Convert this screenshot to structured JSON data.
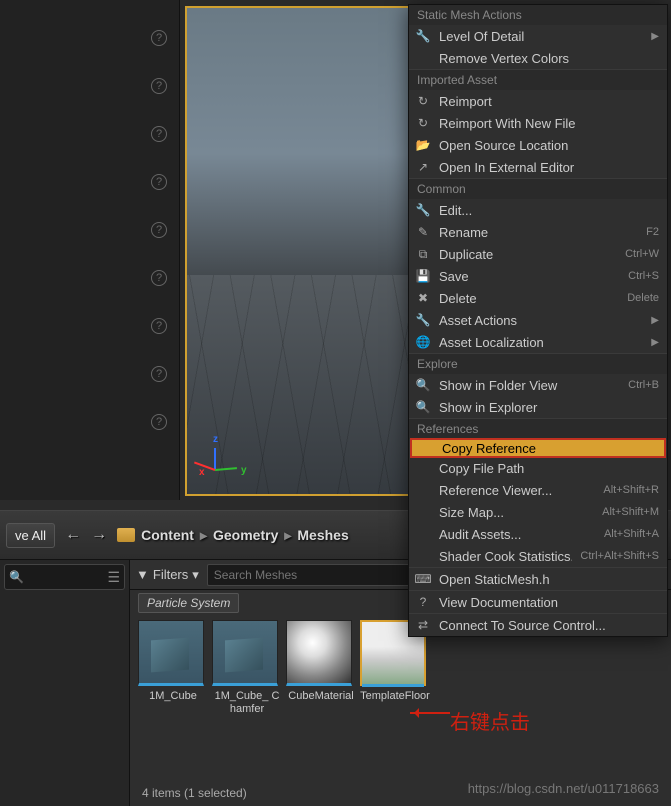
{
  "viewport": {
    "axis": {
      "x": "x",
      "y": "y",
      "z": "z"
    }
  },
  "toolbar": {
    "save_all": "ve All",
    "breadcrumb": [
      "Content",
      "Geometry",
      "Meshes"
    ]
  },
  "filters": {
    "label": "Filters",
    "search_placeholder": "Search Meshes",
    "tag": "Particle System"
  },
  "assets": [
    {
      "label": "1M_Cube",
      "kind": "cube"
    },
    {
      "label": "1M_Cube_Chamfer",
      "kind": "cube"
    },
    {
      "label": "CubeMaterial",
      "kind": "material"
    },
    {
      "label": "TemplateFloor",
      "kind": "floor"
    }
  ],
  "status": "4 items (1 selected)",
  "annotation_text": "右键点击",
  "watermark": "https://blog.csdn.net/u011718663",
  "menu": {
    "sections": [
      {
        "title": "Static Mesh Actions",
        "items": [
          {
            "icon": "wrench",
            "label": "Level Of Detail",
            "sub": true
          },
          {
            "icon": "",
            "label": "Remove Vertex Colors"
          }
        ]
      },
      {
        "title": "Imported Asset",
        "items": [
          {
            "icon": "reimport",
            "label": "Reimport"
          },
          {
            "icon": "reimport",
            "label": "Reimport With New File"
          },
          {
            "icon": "folder-open",
            "label": "Open Source Location"
          },
          {
            "icon": "external",
            "label": "Open In External Editor"
          }
        ]
      },
      {
        "title": "Common",
        "items": [
          {
            "icon": "wrench",
            "label": "Edit..."
          },
          {
            "icon": "rename",
            "label": "Rename",
            "shortcut": "F2"
          },
          {
            "icon": "duplicate",
            "label": "Duplicate",
            "shortcut": "Ctrl+W"
          },
          {
            "icon": "save",
            "label": "Save",
            "shortcut": "Ctrl+S"
          },
          {
            "icon": "delete",
            "label": "Delete",
            "shortcut": "Delete"
          },
          {
            "icon": "wrench",
            "label": "Asset Actions",
            "sub": true
          },
          {
            "icon": "globe",
            "label": "Asset Localization",
            "sub": true
          }
        ]
      },
      {
        "title": "Explore",
        "items": [
          {
            "icon": "search",
            "label": "Show in Folder View",
            "shortcut": "Ctrl+B"
          },
          {
            "icon": "search",
            "label": "Show in Explorer"
          }
        ]
      },
      {
        "title": "References",
        "items": [
          {
            "icon": "",
            "label": "Copy Reference",
            "highlight": true
          },
          {
            "icon": "",
            "label": "Copy File Path"
          },
          {
            "icon": "",
            "label": "Reference Viewer...",
            "shortcut": "Alt+Shift+R"
          },
          {
            "icon": "",
            "label": "Size Map...",
            "shortcut": "Alt+Shift+M"
          },
          {
            "icon": "",
            "label": "Audit Assets...",
            "shortcut": "Alt+Shift+A"
          },
          {
            "icon": "",
            "label": "Shader Cook Statistics...",
            "shortcut": "Ctrl+Alt+Shift+S"
          }
        ]
      },
      {
        "title": "",
        "items": [
          {
            "icon": "code",
            "label": "Open StaticMesh.h"
          }
        ]
      },
      {
        "title": "",
        "items": [
          {
            "icon": "help",
            "label": "View Documentation"
          }
        ]
      },
      {
        "title": "",
        "items": [
          {
            "icon": "source",
            "label": "Connect To Source Control..."
          }
        ]
      }
    ]
  }
}
